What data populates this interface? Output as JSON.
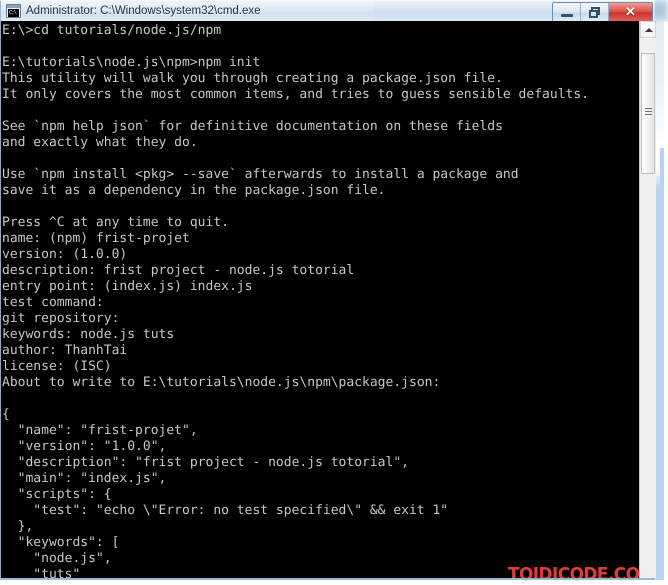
{
  "window": {
    "title": "Administrator: C:\\Windows\\system32\\cmd.exe",
    "icon_name": "cmd-console-icon",
    "icon_text": "C:\\",
    "buttons": {
      "minimize_label": "Minimize",
      "restore_label": "Restore",
      "close_label": "✕"
    }
  },
  "console": {
    "background_color": "#000000",
    "text_color": "#c6c6c6",
    "content": "E:\\>cd tutorials/node.js/npm\n\nE:\\tutorials\\node.js\\npm>npm init\nThis utility will walk you through creating a package.json file.\nIt only covers the most common items, and tries to guess sensible defaults.\n\nSee `npm help json` for definitive documentation on these fields\nand exactly what they do.\n\nUse `npm install <pkg> --save` afterwards to install a package and\nsave it as a dependency in the package.json file.\n\nPress ^C at any time to quit.\nname: (npm) frist-projet\nversion: (1.0.0)\ndescription: frist project - node.js totorial\nentry point: (index.js) index.js\ntest command:\ngit repository:\nkeywords: node.js tuts\nauthor: ThanhTai\nlicense: (ISC)\nAbout to write to E:\\tutorials\\node.js\\npm\\package.json:\n\n{\n  \"name\": \"frist-projet\",\n  \"version\": \"1.0.0\",\n  \"description\": \"frist project - node.js totorial\",\n  \"main\": \"index.js\",\n  \"scripts\": {\n    \"test\": \"echo \\\"Error: no test specified\\\" && exit 1\"\n  },\n  \"keywords\": [\n    \"node.js\",\n    \"tuts\"\n  ],\n  \"author\": \"ThanhTai\",\n  \"license\": \"ISC\"\n}\n\n\nIs this ok? (yes) yes\n\nE:\\tutorials\\node.js\\npm>"
  },
  "watermark": {
    "text": "TOIDICODE.COM",
    "color": "#e23b3b"
  },
  "scrollbar": {
    "up_arrow_name": "scroll-up-arrow",
    "thumb_name": "scroll-thumb"
  }
}
